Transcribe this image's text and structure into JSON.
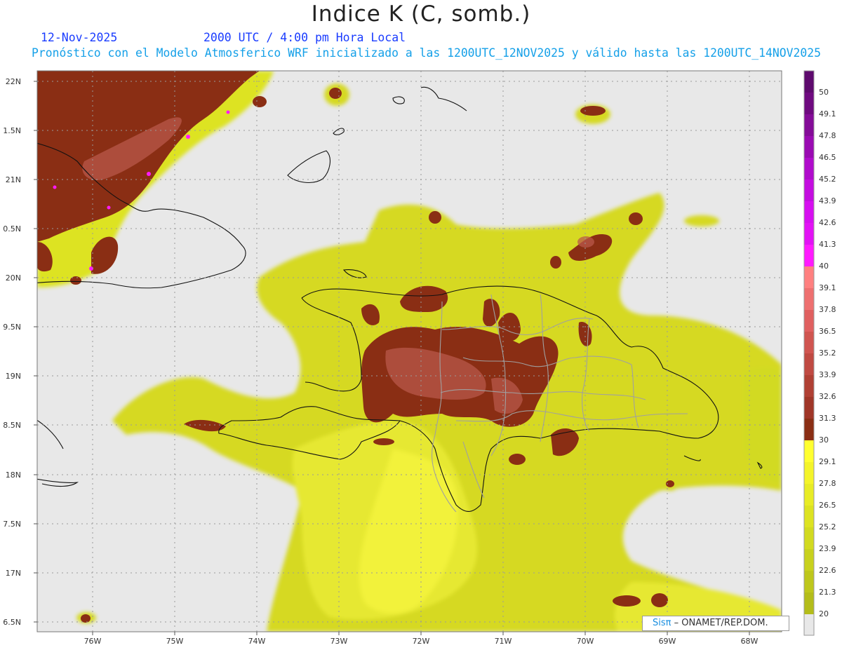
{
  "header": {
    "title": "Indice K (C, somb.)",
    "date": "12-Nov-2025",
    "time": "2000 UTC / 4:00 pm Hora Local",
    "info": "Pronóstico con el Modelo Atmosferico WRF inicializado a las 1200UTC_12NOV2025 y válido hasta las  1200UTC_14NOV2025"
  },
  "map": {
    "lat_labels": [
      "22N",
      "1.5N",
      "21N",
      "0.5N",
      "20N",
      "9.5N",
      "19N",
      "8.5N",
      "18N",
      "7.5N",
      "17N",
      "6.5N"
    ],
    "lon_labels": [
      "76W",
      "75W",
      "74W",
      "73W",
      "72W",
      "71W",
      "70W",
      "69W",
      "68W"
    ],
    "lat_range": [
      16.5,
      22.1
    ],
    "lon_range": [
      -76.6,
      -67.6
    ],
    "grid": true
  },
  "legend": {
    "labels": [
      "50",
      "49.1",
      "47.8",
      "46.5",
      "45.2",
      "43.9",
      "42.6",
      "41.3",
      "40",
      "39.1",
      "37.8",
      "36.5",
      "35.2",
      "33.9",
      "32.6",
      "31.3",
      "30",
      "29.1",
      "27.8",
      "26.5",
      "25.2",
      "23.9",
      "22.6",
      "21.3",
      "20"
    ],
    "colors": [
      "#5e0a6e",
      "#6f0a80",
      "#840c98",
      "#9a0bb2",
      "#b00ccc",
      "#c40de0",
      "#d60ff0",
      "#e212f5",
      "#ff1aff",
      "#ff8080",
      "#ee7070",
      "#e06060",
      "#d05550",
      "#c04a42",
      "#b04034",
      "#a03628",
      "#8a2e14",
      "#ffff30",
      "#f4f42a",
      "#e8ec26",
      "#dde322",
      "#d2da20",
      "#c8d11e",
      "#bec71c",
      "#b4bd1a"
    ],
    "nodata_color": "#e8e8e8"
  },
  "footer": {
    "brand": "Sisπ",
    "org": "– ONAMET/REP.DOM."
  }
}
